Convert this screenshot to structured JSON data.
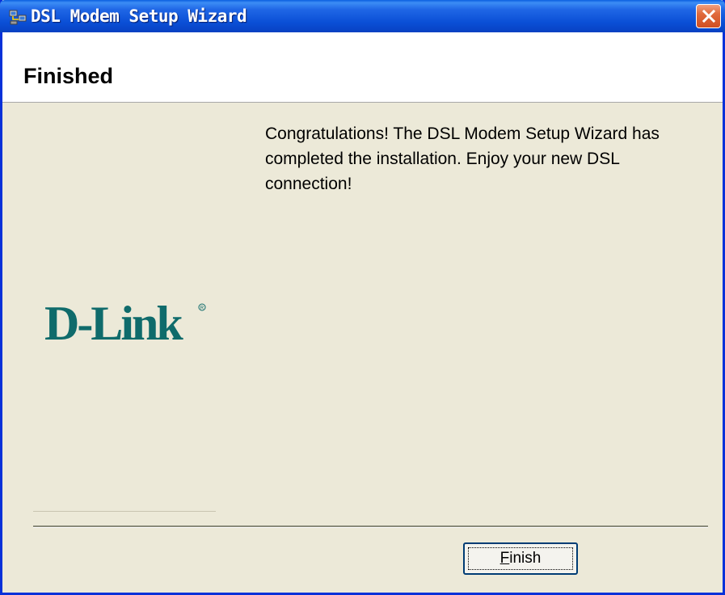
{
  "window": {
    "title": "DSL Modem Setup Wizard",
    "title_icon": "computer-network-icon",
    "close_icon": "close-icon",
    "close_color": "#d14f22",
    "titlebar_color": "#0a4fd6"
  },
  "header": {
    "title": "Finished"
  },
  "body": {
    "message": "Congratulations!  The DSL Modem Setup Wizard has completed the installation.  Enjoy your new DSL connection!"
  },
  "logo": {
    "text": "D-Link",
    "color": "#0f6b6b"
  },
  "footer": {
    "finish_accel": "F",
    "finish_rest": "inish"
  }
}
